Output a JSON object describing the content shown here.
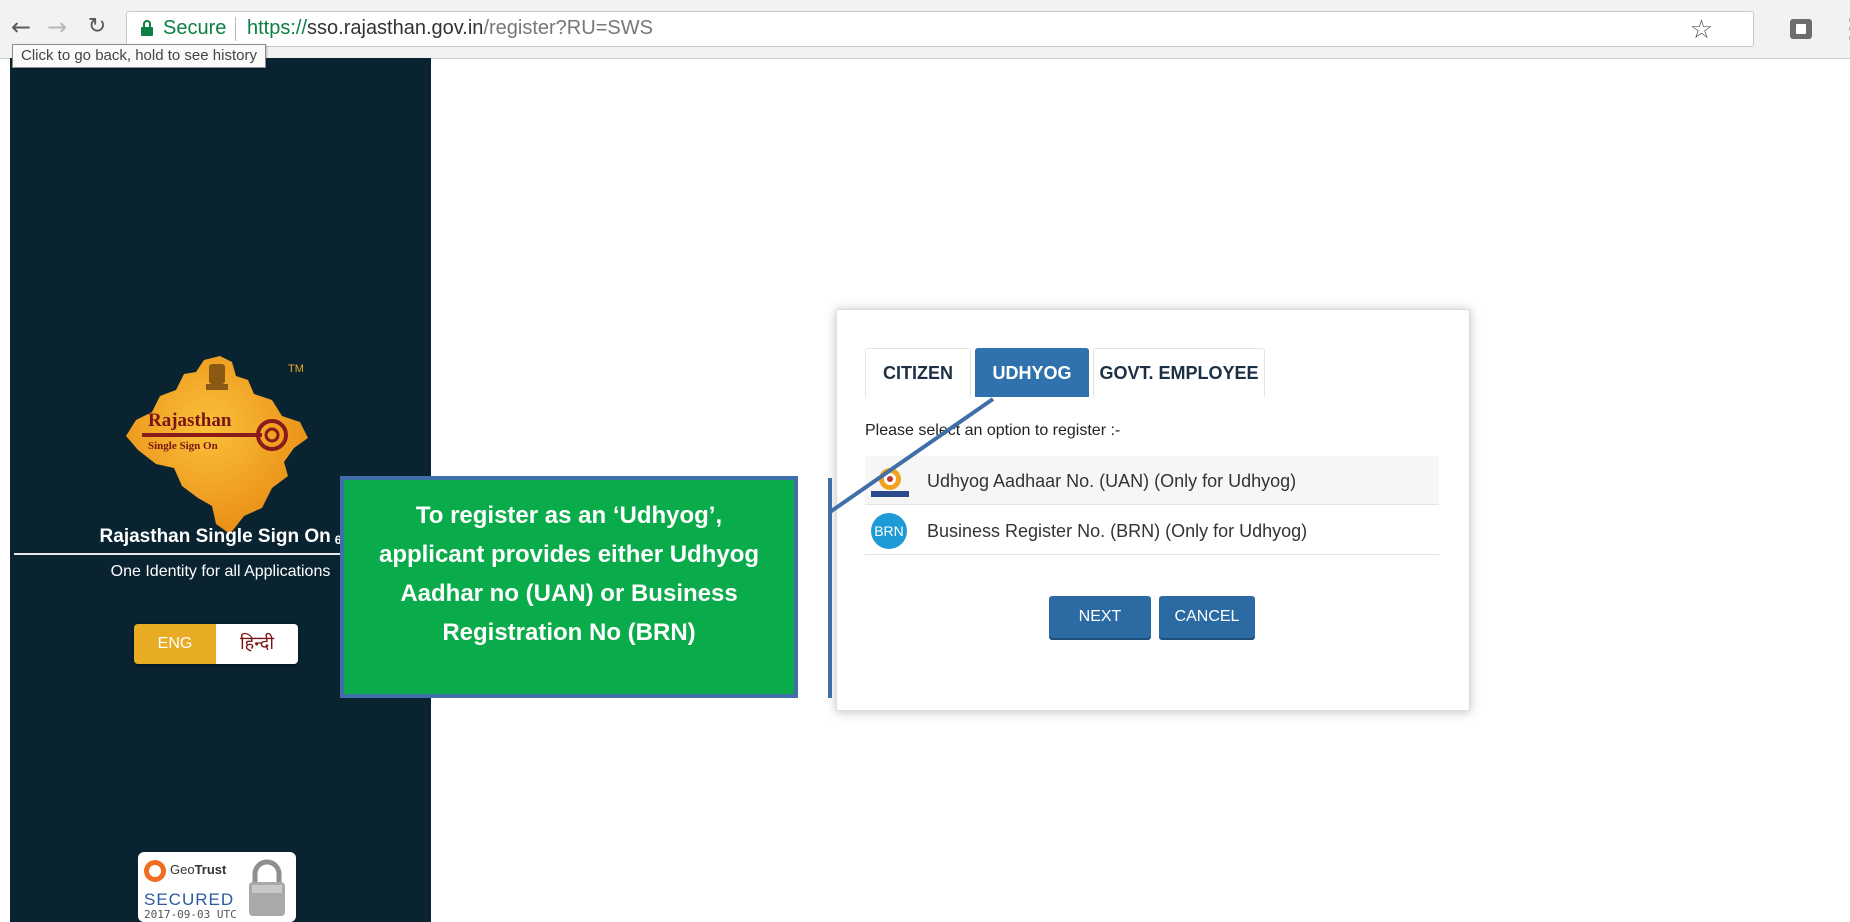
{
  "browser": {
    "secure_label": "Secure",
    "url_scheme": "https://",
    "url_host": "sso.rajasthan.gov.in",
    "url_path": "/register?RU=SWS",
    "back_tooltip": "Click to go back, hold to see history",
    "icons": [
      "back-arrow-icon",
      "forward-arrow-icon",
      "reload-icon",
      "lock-icon",
      "star-icon",
      "extension-icon",
      "menu-icon"
    ]
  },
  "sidebar": {
    "logo_text_line1": "Rajasthan",
    "logo_text_line2": "Single Sign On",
    "logo_tm": "TM",
    "title": "Rajasthan Single Sign On",
    "title_suffix": "6",
    "tagline": "One Identity for all Applications",
    "lang_eng": "ENG",
    "lang_hindi": "हिन्दी",
    "geotrust_brand_a": "Geo",
    "geotrust_brand_b": "Trust",
    "geotrust_secured": "SECURED",
    "geotrust_date": "2017-09-03 UTC",
    "colors": {
      "background": "#092331",
      "eng_button": "#e8ab24"
    }
  },
  "callout": {
    "lines": [
      "To register as an ‘Udhyog’,",
      "applicant provides either Udhyog",
      "Aadhar no (UAN) or Business",
      "Registration No (BRN)"
    ],
    "colors": {
      "fill": "#0aab4a",
      "border": "#3f6ea8"
    }
  },
  "register": {
    "tabs": [
      {
        "label": "CITIZEN",
        "active": false
      },
      {
        "label": "UDHYOG",
        "active": true
      },
      {
        "label": "GOVT. EMPLOYEE",
        "active": false
      }
    ],
    "prompt": "Please select an option to register :-",
    "options": [
      {
        "icon": "uan-logo-icon",
        "label": "Udhyog Aadhaar No. (UAN) (Only for Udhyog)"
      },
      {
        "icon": "brn-icon",
        "icon_text": "BRN",
        "label": "Business Register No. (BRN) (Only for Udhyog)"
      }
    ],
    "next_label": "NEXT",
    "cancel_label": "CANCEL",
    "colors": {
      "active_tab": "#2f72ad",
      "button": "#2c6aa3"
    }
  }
}
